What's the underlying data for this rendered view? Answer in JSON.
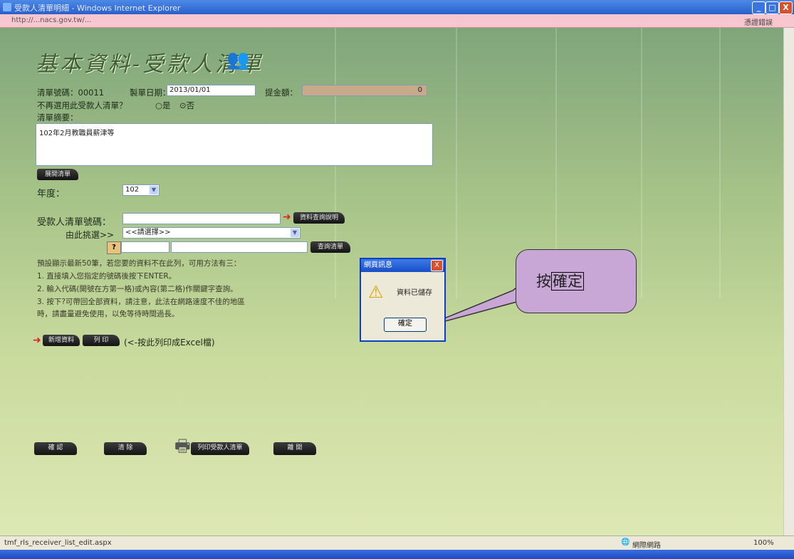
{
  "window": {
    "title": "受款人清單明細 - Windows Internet Explorer",
    "url": "http://...nacs.gov.tw/...",
    "cert_error": "憑證錯誤",
    "min": "_",
    "max": "□",
    "close": "X"
  },
  "page": {
    "heading": "基本資料-受款人清單",
    "form": {
      "list_no_label": "清單號碼：00011",
      "date_label": "製單日期：",
      "date_value": "2013/01/01",
      "total_label": "提金額：",
      "total_value": "0",
      "reuse_question": "不再選用此受款人清單？",
      "radio_yes": "是",
      "radio_no": "否",
      "summary_label": "清單摘要：",
      "summary_value": "102年2月教職員薪津等",
      "expand_button": "展開清單",
      "year_label": "年度：",
      "year_value": "102",
      "payee_no_label": "受款人清單號碼：",
      "search_button": "資料查詢說明",
      "pick_label": "由此挑選>>",
      "pick_value": "<<請選擇>>",
      "help_mark": "?",
      "query_button": "查詢清單"
    },
    "tips": [
      "預設顯示最新50筆，若您要的資料不在此列，可用方法有三：",
      "1. 直接填入您指定的號碼後按下ENTER。",
      "2. 輸入代碼(開號在方第一格)或內容(第二格)作關鍵字查詢。",
      "3. 按下?可帶回全部資料，請注意，此法在網路速度不佳的地區",
      "時，請盡量避免使用，以免等待時間過長。"
    ],
    "add_button": "新增資料",
    "print_button": "列 印",
    "print_hint": "(<-按此列印成Excel檔)",
    "bottom_buttons": [
      "確 認",
      "清 除",
      "列印受款人清單",
      "離 開"
    ]
  },
  "dialog": {
    "title": "網頁訊息",
    "message": "資料已儲存",
    "ok": "確定",
    "close": "X"
  },
  "callout": {
    "prefix": "按",
    "boxed": "確定"
  },
  "statusbar": {
    "left": "tmf_rls_receiver_list_edit.aspx",
    "zone": "網際網路",
    "zoom": "100%"
  }
}
